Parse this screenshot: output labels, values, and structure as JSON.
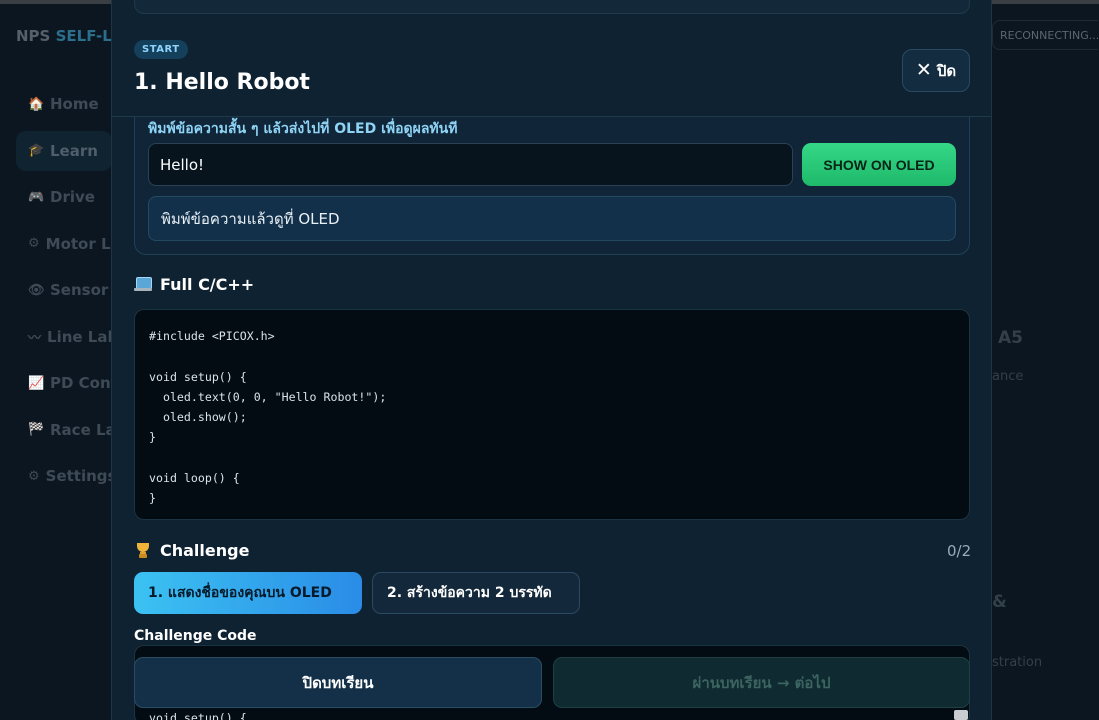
{
  "background": {
    "brand_prefix": "NPS",
    "brand_highlight": "SELF-L",
    "status": "RECONNECTING...",
    "nav": [
      {
        "icon": "home-icon",
        "glyph": "🏠",
        "label": "Home"
      },
      {
        "icon": "learn-icon",
        "glyph": "🎓",
        "label": "Learn"
      },
      {
        "icon": "drive-icon",
        "glyph": "🎮",
        "label": "Drive"
      },
      {
        "icon": "motor-icon",
        "glyph": "⚙",
        "label": "Motor Lab"
      },
      {
        "icon": "sensor-icon",
        "glyph": "👁",
        "label": "Sensor Lab"
      },
      {
        "icon": "line-icon",
        "glyph": "〰",
        "label": "Line Lab"
      },
      {
        "icon": "pd-icon",
        "glyph": "📈",
        "label": "PD Control"
      },
      {
        "icon": "race-icon",
        "glyph": "🏁",
        "label": "Race Lab"
      },
      {
        "icon": "settings-icon",
        "glyph": "⚙",
        "label": "Settings"
      }
    ],
    "frag_a5": "A5",
    "frag_ance": "ance",
    "frag_amp": "&",
    "frag_stration": "stration"
  },
  "modal": {
    "badge": "START",
    "title": "1. Hello Robot",
    "close_label": "ปิด",
    "hint": "พิมพ์ข้อความสั้น ๆ แล้วส่งไปที่ OLED เพื่อดูผลทันที",
    "input_value": "Hello!",
    "show_button": "SHOW ON OLED",
    "status_text": "พิมพ์ข้อความแล้วดูที่ OLED",
    "code_title": "Full C/C++",
    "code": "#include <PICOX.h>\n\nvoid setup() {\n  oled.text(0, 0, \"Hello Robot!\");\n  oled.show();\n}\n\nvoid loop() {\n}",
    "challenge_title": "Challenge",
    "progress": "0/2",
    "challenges": [
      "1. แสดงชื่อของคุณบน OLED",
      "2. สร้างข้อความ 2 บรรทัด"
    ],
    "challenge_code_label": "Challenge Code",
    "challenge_code_peek": "void setup() {",
    "close_lesson": "ปิดบทเรียน",
    "pass_lesson": "ผ่านบทเรียน → ต่อไป"
  }
}
